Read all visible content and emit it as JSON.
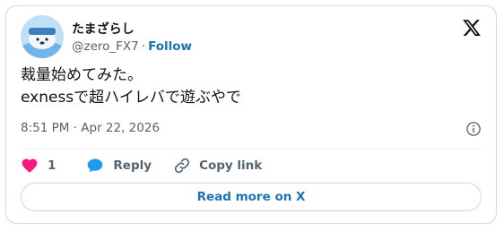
{
  "author": {
    "display_name": "たまざらし",
    "handle": "@zero_FX7",
    "separator": "·",
    "follow_label": "Follow",
    "avatar_icon": "seal-avatar-icon"
  },
  "post": {
    "text_lines": [
      "裁量始めてみた。",
      "exnessで超ハイレバで遊ぶやで"
    ],
    "timestamp": "8:51 PM · Apr 22, 2026"
  },
  "actions": {
    "like_count": "1",
    "reply_label": "Reply",
    "copy_link_label": "Copy link"
  },
  "read_more_label": "Read more on X",
  "colors": {
    "like": "#f91880",
    "reply": "#1d9bf0",
    "link": "#1d73b8",
    "muted": "#536471",
    "border": "#cfd9de"
  }
}
